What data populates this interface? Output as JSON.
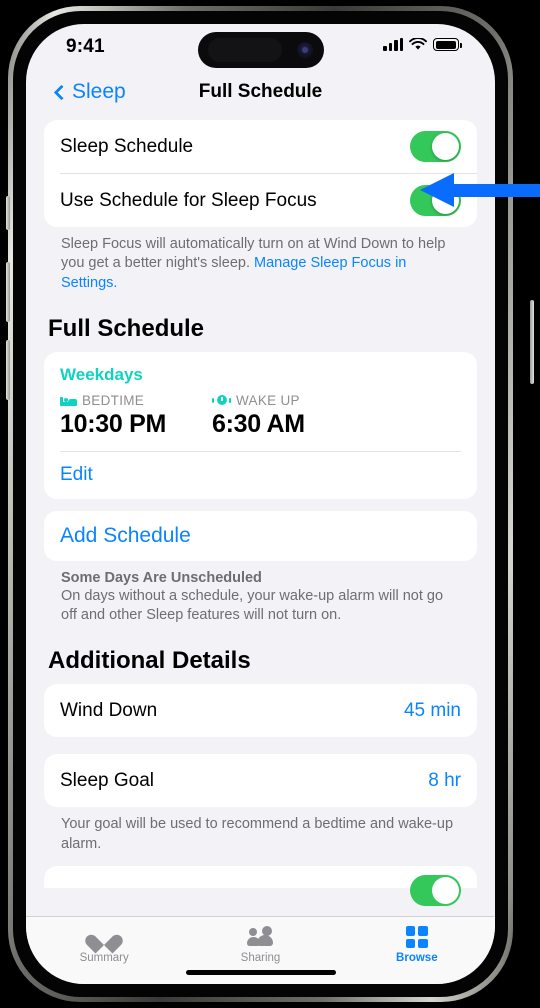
{
  "status_bar": {
    "time": "9:41",
    "signal_icon": "cellular-bars-icon",
    "wifi_icon": "wifi-icon",
    "battery_icon": "battery-full-icon"
  },
  "nav": {
    "back_label": "Sleep",
    "back_icon": "chevron-left-icon",
    "title": "Full Schedule"
  },
  "toggles": {
    "sleep_schedule": {
      "label": "Sleep Schedule",
      "state": "on"
    },
    "use_schedule_focus": {
      "label": "Use Schedule for Sleep Focus",
      "state": "on"
    }
  },
  "focus_note": {
    "text": "Sleep Focus will automatically turn on at Wind Down to help you get a better night's sleep. ",
    "link": "Manage Sleep Focus in Settings."
  },
  "full_schedule": {
    "heading": "Full Schedule",
    "days": "Weekdays",
    "bedtime": {
      "icon": "bed-icon",
      "label": "BEDTIME",
      "time": "10:30 PM"
    },
    "wakeup": {
      "icon": "alarm-clock-icon",
      "label": "WAKE UP",
      "time": "6:30 AM"
    },
    "edit_label": "Edit",
    "add_label": "Add Schedule",
    "unscheduled_title": "Some Days Are Unscheduled",
    "unscheduled_body": "On days without a schedule, your wake-up alarm will not go off and other Sleep features will not turn on."
  },
  "additional_details": {
    "heading": "Additional Details",
    "wind_down": {
      "label": "Wind Down",
      "value": "45 min"
    },
    "sleep_goal": {
      "label": "Sleep Goal",
      "value": "8 hr"
    },
    "sleep_goal_note": "Your goal will be used to recommend a bedtime and wake-up alarm."
  },
  "tabbar": [
    {
      "label": "Summary",
      "icon": "heart-icon",
      "active": false
    },
    {
      "label": "Sharing",
      "icon": "people-icon",
      "active": false
    },
    {
      "label": "Browse",
      "icon": "grid-icon",
      "active": true
    }
  ],
  "annotation": {
    "type": "arrow-left",
    "color": "#0A6CFF",
    "points_at": "sleep-schedule-toggle"
  },
  "colors": {
    "accent_blue": "#0A84FF",
    "toggle_green": "#34C759",
    "teal": "#0FD3C0",
    "background": "#F2F2F7"
  }
}
